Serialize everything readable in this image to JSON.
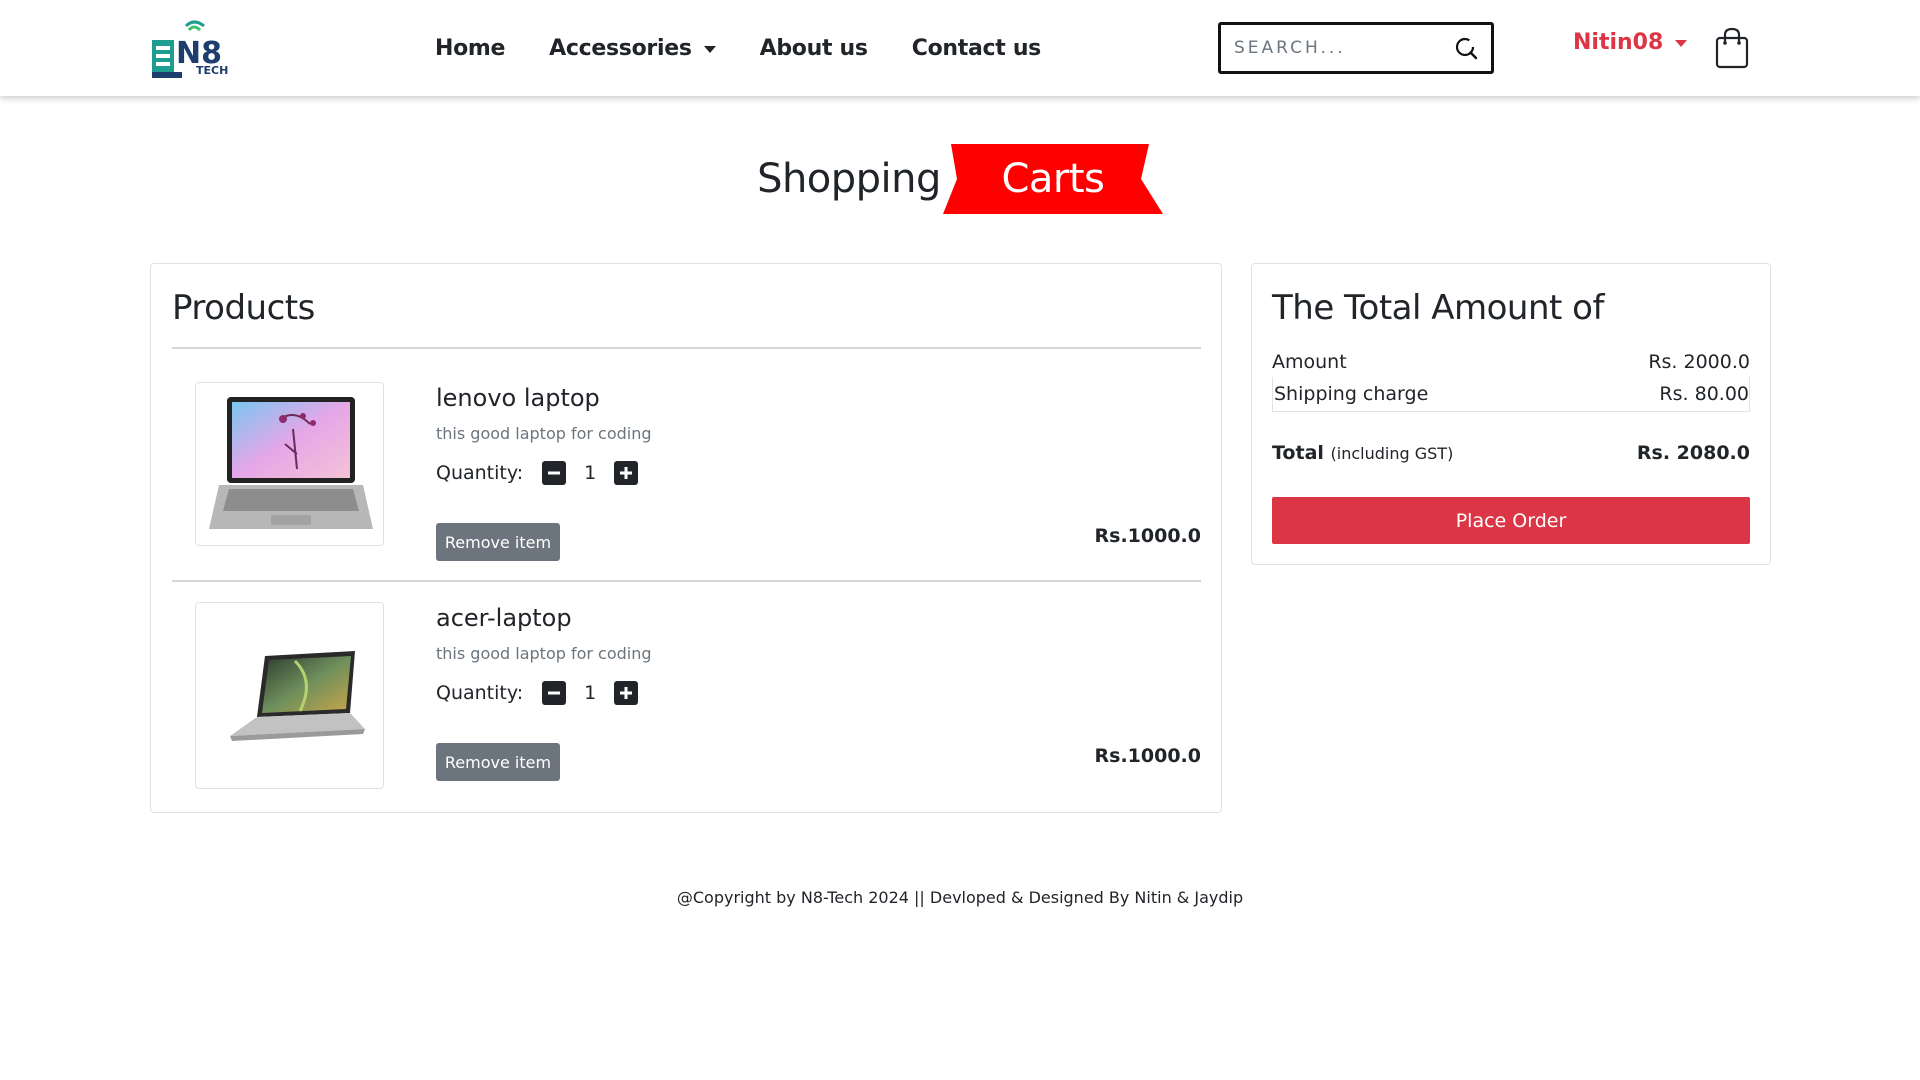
{
  "brand": {
    "logo_text": "N8",
    "logo_sub": "TECH"
  },
  "nav": {
    "items": [
      {
        "label": "Home"
      },
      {
        "label": "Accessories"
      },
      {
        "label": "About us"
      },
      {
        "label": "Contact us"
      }
    ]
  },
  "search": {
    "placeholder": "SEARCH..."
  },
  "user": {
    "name": "Nitin08"
  },
  "heading": {
    "part1": "Shopping",
    "part2": "Carts"
  },
  "products": {
    "title": "Products",
    "quantity_label": "Quantity:",
    "remove_label": "Remove item",
    "items": [
      {
        "name": "lenovo laptop",
        "description": "this good laptop for coding",
        "quantity": "1",
        "price": "Rs.1000.0"
      },
      {
        "name": "acer-laptop",
        "description": "this good laptop for coding",
        "quantity": "1",
        "price": "Rs.1000.0"
      }
    ]
  },
  "summary": {
    "title": "The Total Amount of",
    "amount_label": "Amount",
    "amount_value": "Rs. 2000.0",
    "shipping_label": "Shipping charge",
    "shipping_value": "Rs. 80.00",
    "total_label": "Total",
    "total_note": "(including GST)",
    "total_value": "Rs. 2080.0",
    "place_order_label": "Place Order"
  },
  "footer": {
    "text": "@Copyright by N8-Tech 2024 || Devloped & Designed By Nitin & Jaydip"
  },
  "colors": {
    "accent": "#dc3545",
    "dark": "#212529",
    "muted": "#6c757d",
    "logo_teal": "#1f9e8f",
    "logo_navy": "#1c3d6e"
  }
}
